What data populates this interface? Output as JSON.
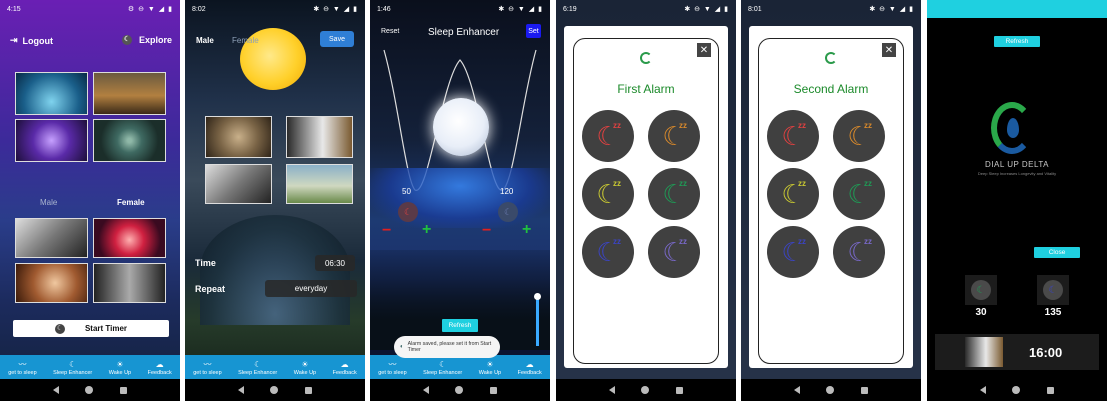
{
  "screens": {
    "s1": {
      "time": "4:15",
      "logout_label": "Logout",
      "explore_label": "Explore",
      "male_label": "Male",
      "female_label": "Female",
      "start_timer_label": "Start Timer"
    },
    "s2": {
      "time": "8:02",
      "male_label": "Male",
      "female_label": "Female",
      "save_label": "Save",
      "time_label": "Time",
      "time_value": "06:30",
      "repeat_label": "Repeat",
      "repeat_value": "everyday"
    },
    "s3": {
      "time": "1:46",
      "reset_label": "Reset",
      "title": "Sleep Enhancer",
      "set_label": "Set",
      "left_value": "50",
      "right_value": "120",
      "refresh_label": "Refresh",
      "toast": "Alarm saved, please set it from Start Timer"
    },
    "s4": {
      "time": "6:19",
      "alarm_title": "First Alarm"
    },
    "s5": {
      "time": "8:01",
      "alarm_title": "Second Alarm"
    },
    "s6": {
      "refresh_label": "Refresh",
      "logo_title": "DIAL UP DELTA",
      "logo_tagline": "Deep Sleep Increases Longevity and Vitality",
      "close_label": "Close",
      "value_left": "30",
      "value_right": "135",
      "clock": "16:00"
    }
  },
  "bottom_tabs": [
    "get to sleep",
    "Sleep Enhancer",
    "Wake Up",
    "Feedback"
  ],
  "alarm_colors": [
    "#e04141",
    "#d8892b",
    "#c8c832",
    "#1f9a55",
    "#3b44c4",
    "#7868c8"
  ],
  "colors": {
    "tab_bar": "#1795d2",
    "accent_cyan": "#1fd0e0",
    "alarm_title_green": "#1b8a2a",
    "save_blue": "#2f7fd6"
  }
}
